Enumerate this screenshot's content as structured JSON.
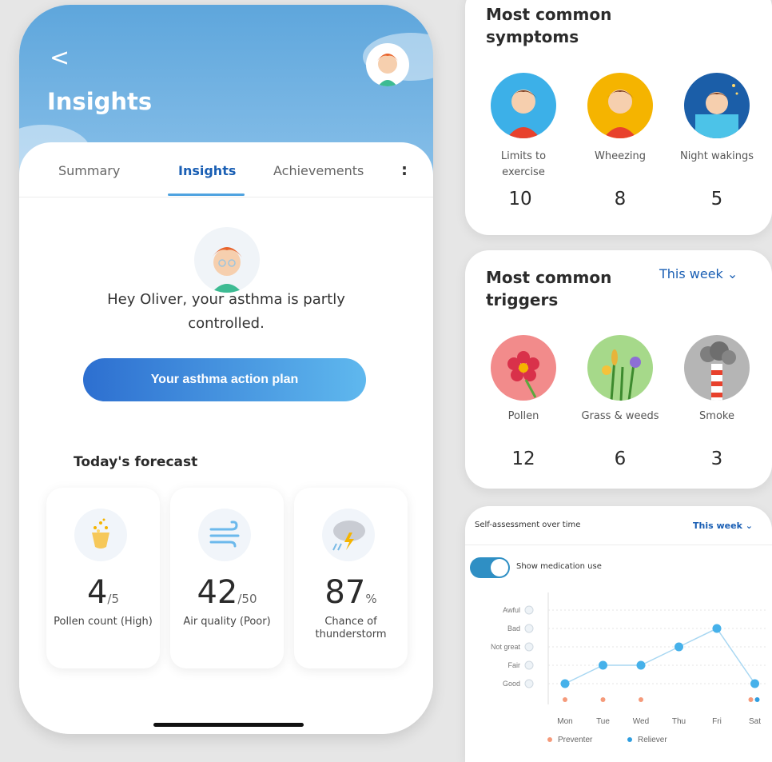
{
  "phone": {
    "back_label": "<",
    "title": "Insights",
    "tabs": [
      {
        "label": "Summary"
      },
      {
        "label": "Insights"
      },
      {
        "label": "Achievements"
      }
    ],
    "more_label": ":",
    "message": "Hey Oliver, your asthma is partly controlled.",
    "action_button": "Your asthma action plan",
    "forecast_title": "Today's forecast",
    "forecast": [
      {
        "icon": "flower-icon",
        "value": "4",
        "unit": "/5",
        "label": "Pollen count (High)"
      },
      {
        "icon": "wind-icon",
        "value": "42",
        "unit": "/50",
        "label": "Air quality (Poor)"
      },
      {
        "icon": "thunderstorm-icon",
        "value": "87",
        "unit": "%",
        "label": "Chance of thunderstorm"
      }
    ]
  },
  "symptoms": {
    "title": "Most common symptoms",
    "items": [
      {
        "label": "Limits to exercise",
        "count": "10",
        "color": "#3cb0e8"
      },
      {
        "label": "Wheezing",
        "count": "8",
        "color": "#f5b400"
      },
      {
        "label": "Night wakings",
        "count": "5",
        "color": "#1b5ea8"
      }
    ]
  },
  "triggers": {
    "title": "Most common triggers",
    "period": "This week",
    "items": [
      {
        "label": "Pollen",
        "count": "12",
        "color": "#f28b8b"
      },
      {
        "label": "Grass & weeds",
        "count": "6",
        "color": "#a6d98a"
      },
      {
        "label": "Smoke",
        "count": "3",
        "color": "#b5b5b5"
      }
    ]
  },
  "assessment": {
    "title": "Self-assessment over time",
    "period": "This week",
    "toggle_label": "Show medication use",
    "toggle_on": true,
    "chart_data": {
      "type": "line",
      "categories": [
        "Mon",
        "Tue",
        "Wed",
        "Thu",
        "Fri",
        "Sat"
      ],
      "levels": [
        "Awful",
        "Bad",
        "Not great",
        "Fair",
        "Good"
      ],
      "series": [
        {
          "name": "Self-assessment",
          "values": [
            "Good",
            "Fair",
            "Fair",
            "Not great",
            "Bad",
            "Good"
          ],
          "color": "#46b1ea"
        }
      ],
      "medication": {
        "preventer": [
          1,
          1,
          1,
          0,
          0,
          1
        ],
        "reliever": [
          0,
          0,
          0,
          0,
          0,
          1
        ]
      },
      "legend": [
        {
          "name": "Preventer",
          "color": "#f59a7a"
        },
        {
          "name": "Reliever",
          "color": "#2f9ee0"
        }
      ]
    }
  }
}
